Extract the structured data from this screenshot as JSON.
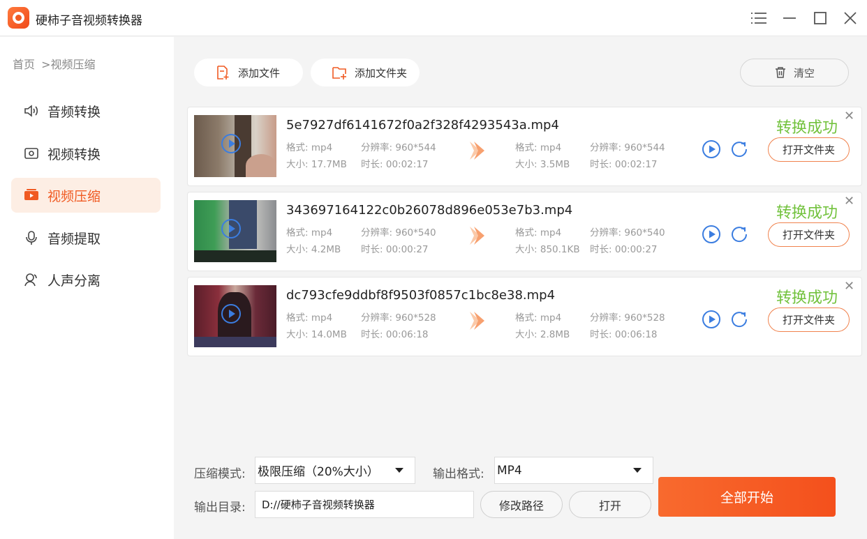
{
  "app": {
    "title": "硬柿子音视频转换器"
  },
  "breadcrumb": {
    "home": "首页",
    "current": ">视频压缩"
  },
  "sidebar": {
    "items": [
      {
        "label": "音频转换",
        "icon": "audio-convert-icon"
      },
      {
        "label": "视频转换",
        "icon": "video-convert-icon"
      },
      {
        "label": "视频压缩",
        "icon": "video-compress-icon",
        "active": true
      },
      {
        "label": "音频提取",
        "icon": "audio-extract-icon"
      },
      {
        "label": "人声分离",
        "icon": "vocal-separate-icon"
      }
    ]
  },
  "toolbar": {
    "add_file": "添加文件",
    "add_folder": "添加文件夹",
    "clear": "清空"
  },
  "labels": {
    "format": "格式:",
    "resolution": "分辨率:",
    "size": "大小:",
    "duration": "时长:"
  },
  "files": [
    {
      "name": "5e7927df6141672f0a2f328f4293543a.mp4",
      "src": {
        "format": "mp4",
        "resolution": "960*544",
        "size": "17.7MB",
        "duration": "00:02:17"
      },
      "out": {
        "format": "mp4",
        "resolution": "960*544",
        "size": "3.5MB",
        "duration": "00:02:17"
      },
      "status": "转换成功",
      "open_folder": "打开文件夹"
    },
    {
      "name": "343697164122c0b26078d896e053e7b3.mp4",
      "src": {
        "format": "mp4",
        "resolution": "960*540",
        "size": "4.2MB",
        "duration": "00:00:27"
      },
      "out": {
        "format": "mp4",
        "resolution": "960*540",
        "size": "850.1KB",
        "duration": "00:00:27"
      },
      "status": "转换成功",
      "open_folder": "打开文件夹"
    },
    {
      "name": "dc793cfe9ddbf8f9503f0857c1bc8e38.mp4",
      "src": {
        "format": "mp4",
        "resolution": "960*528",
        "size": "14.0MB",
        "duration": "00:06:18"
      },
      "out": {
        "format": "mp4",
        "resolution": "960*528",
        "size": "2.8MB",
        "duration": "00:06:18"
      },
      "status": "转换成功",
      "open_folder": "打开文件夹"
    }
  ],
  "settings": {
    "mode_label": "压缩模式:",
    "mode_value": "极限压缩（20%大小）",
    "format_label": "输出格式:",
    "format_value": "MP4",
    "dir_label": "输出目录:",
    "dir_value": "D://硬柿子音视频转换器",
    "change_path": "修改路径",
    "open": "打开",
    "start_all": "全部开始"
  },
  "colors": {
    "accent": "#f05a22",
    "success": "#72c23d",
    "link": "#3b7de0"
  }
}
